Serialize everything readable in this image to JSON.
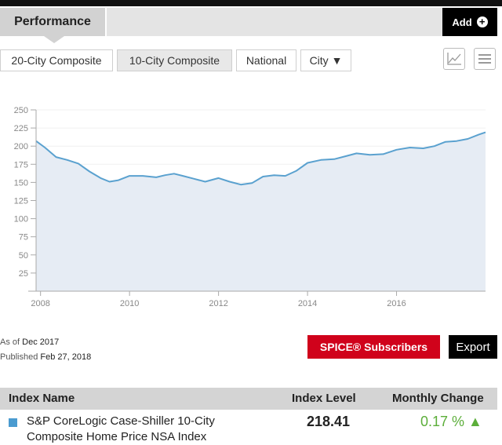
{
  "header": {
    "performance_tab": "Performance",
    "add_label": "Add",
    "add_icon": "plus-circle-icon"
  },
  "filters": [
    {
      "label": "20-City Composite",
      "active": false
    },
    {
      "label": "10-City Composite",
      "active": true
    },
    {
      "label": "National",
      "active": false
    },
    {
      "label": "City ▼",
      "active": false
    }
  ],
  "view_controls": [
    "line-chart-icon",
    "menu-icon"
  ],
  "chart_data": {
    "type": "area",
    "title": "",
    "xlabel": "",
    "ylabel": "",
    "xlim": [
      2007.9,
      2018.0
    ],
    "ylim": [
      0,
      250
    ],
    "x_ticks": [
      "2008",
      "2010",
      "2012",
      "2014",
      "2016"
    ],
    "y_ticks": [
      "25",
      "50",
      "75",
      "100",
      "125",
      "150",
      "175",
      "200",
      "225",
      "250"
    ],
    "grid": true,
    "series": [
      {
        "color": "#5aa1cf",
        "fill": "#e6ecf4",
        "points": [
          [
            2007.9,
            207
          ],
          [
            2008.1,
            198
          ],
          [
            2008.35,
            185
          ],
          [
            2008.6,
            181
          ],
          [
            2008.85,
            176
          ],
          [
            2009.1,
            165
          ],
          [
            2009.35,
            156
          ],
          [
            2009.55,
            151
          ],
          [
            2009.75,
            153
          ],
          [
            2010.0,
            159
          ],
          [
            2010.3,
            159
          ],
          [
            2010.6,
            157
          ],
          [
            2010.8,
            160
          ],
          [
            2011.0,
            162
          ],
          [
            2011.2,
            159
          ],
          [
            2011.45,
            155
          ],
          [
            2011.7,
            151
          ],
          [
            2012.0,
            156
          ],
          [
            2012.25,
            151
          ],
          [
            2012.5,
            147
          ],
          [
            2012.75,
            149
          ],
          [
            2013.0,
            158
          ],
          [
            2013.25,
            160
          ],
          [
            2013.5,
            159
          ],
          [
            2013.75,
            166
          ],
          [
            2014.0,
            177
          ],
          [
            2014.3,
            181
          ],
          [
            2014.6,
            182
          ],
          [
            2014.85,
            186
          ],
          [
            2015.1,
            190
          ],
          [
            2015.4,
            188
          ],
          [
            2015.7,
            189
          ],
          [
            2016.0,
            195
          ],
          [
            2016.3,
            198
          ],
          [
            2016.6,
            197
          ],
          [
            2016.85,
            200
          ],
          [
            2017.1,
            206
          ],
          [
            2017.35,
            207
          ],
          [
            2017.6,
            210
          ],
          [
            2017.85,
            216
          ],
          [
            2018.0,
            219
          ]
        ]
      }
    ]
  },
  "info": {
    "as_of_label": "As of",
    "as_of_value": "Dec 2017",
    "published_label": "Published",
    "published_value": "Feb 27, 2018"
  },
  "actions": {
    "spice_label": "SPICE® Subscribers",
    "export_label": "Export"
  },
  "table": {
    "headers": [
      "Index Name",
      "Index Level",
      "Monthly Change"
    ],
    "rows": [
      {
        "name_line1": "S&P CoreLogic Case-Shiller 10-City",
        "name_line2": "Composite Home Price NSA Index",
        "level": "218.41",
        "change": "0.17 % ▲",
        "swatch_color": "#4a9bd0"
      }
    ]
  }
}
